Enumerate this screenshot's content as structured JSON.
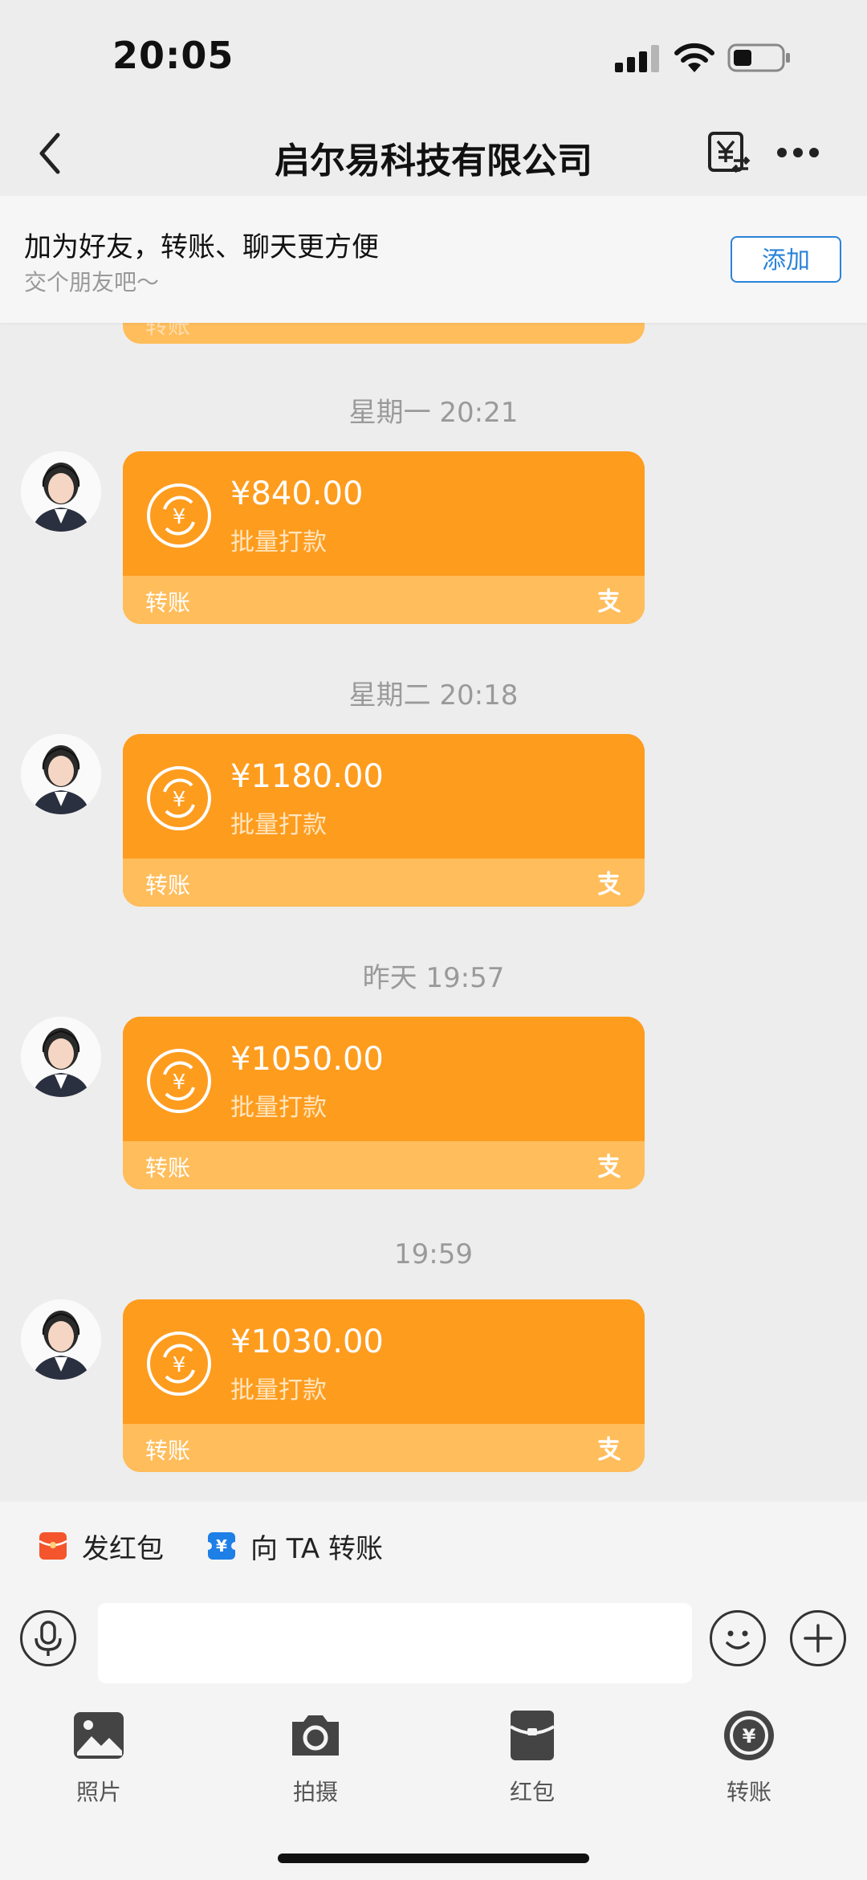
{
  "status_bar": {
    "time": "20:05"
  },
  "nav": {
    "title": "启尔易科技有限公司"
  },
  "banner": {
    "title": "加为好友，转账、聊天更方便",
    "subtitle": "交个朋友吧～",
    "add_label": "添加"
  },
  "messages": [
    {
      "timestamp": "星期一 20:21",
      "amount": "¥840.00",
      "memo": "批量打款",
      "card_label": "转账"
    },
    {
      "timestamp": "星期二 20:18",
      "amount": "¥1180.00",
      "memo": "批量打款",
      "card_label": "转账"
    },
    {
      "timestamp": "昨天 19:57",
      "amount": "¥1050.00",
      "memo": "批量打款",
      "card_label": "转账"
    },
    {
      "timestamp": "19:59",
      "amount": "¥1030.00",
      "memo": "批量打款",
      "card_label": "转账"
    }
  ],
  "partial_card": {
    "label": "转账"
  },
  "quick_actions": [
    {
      "label": "发红包",
      "icon": "red-packet-icon",
      "color": "#f4552d"
    },
    {
      "label": "向 TA 转账",
      "icon": "transfer-icon",
      "color": "#1e7fe6"
    }
  ],
  "tools": [
    {
      "label": "照片",
      "icon": "photo-icon"
    },
    {
      "label": "拍摄",
      "icon": "camera-icon"
    },
    {
      "label": "红包",
      "icon": "red-packet-icon"
    },
    {
      "label": "转账",
      "icon": "transfer-icon"
    }
  ],
  "colors": {
    "card_top": "#fe9c1e",
    "card_bottom": "#ffbd5b",
    "accent_blue": "#2a83d8",
    "background": "#ededed"
  }
}
